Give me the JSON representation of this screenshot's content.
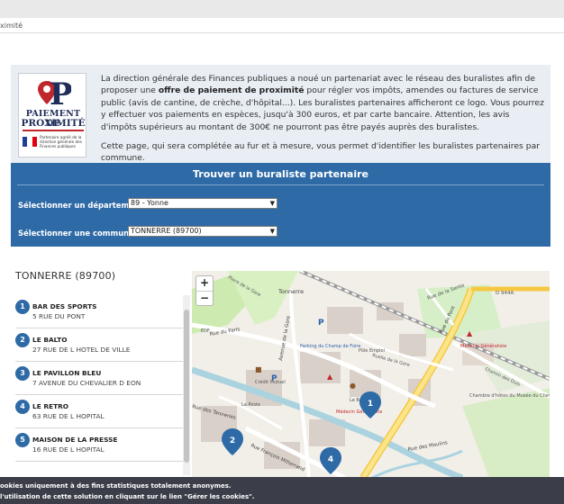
{
  "breadcrumb": {
    "text": "ximité"
  },
  "logo": {
    "line1": "PAIEMENT DE",
    "line2": "PROXIMITÉ",
    "small": "Partenaire agréé de la direction générale des Finances publiques"
  },
  "intro": {
    "p1_a": "La direction générale des Finances publiques a noué un partenariat avec le réseau des buralistes afin de proposer une ",
    "p1_b": "offre de paiement de proximité",
    "p1_c": " pour régler vos impôts, amendes ou factures de service public (avis de cantine, de crèche, d'hôpital...). Les buralistes partenaires afficheront ce logo. Vous pourrez y effectuer vos paiements en espèces, jusqu'à 300 euros, et par carte bancaire. Attention, les avis d'impôts supérieurs au montant de 300€ ne pourront pas être payés auprès des buralistes.",
    "p2": "Cette page, qui sera complétée au fur et à mesure, vous permet d'identifier les buralistes partenaires par commune."
  },
  "finder": {
    "title": "Trouver un buraliste partenaire",
    "dept_label": "Sélectionner un département :",
    "dept_value": "89 - Yonne",
    "commune_label": "Sélectionner une commune :",
    "commune_value": "TONNERRE (89700)"
  },
  "commune_title": "TONNERRE (89700)",
  "results": [
    {
      "n": "1",
      "name": "BAR DES SPORTS",
      "address": "5 RUE DU PONT"
    },
    {
      "n": "2",
      "name": "LE BALTO",
      "address": "27 RUE DE L HOTEL DE VILLE"
    },
    {
      "n": "3",
      "name": "LE PAVILLON BLEU",
      "address": "7 AVENUE DU CHEVALIER D EON"
    },
    {
      "n": "4",
      "name": "LE RETRO",
      "address": "63 RUE DE L HOPITAL"
    },
    {
      "n": "5",
      "name": "MAISON DE LA PRESSE",
      "address": "16 RUE DE L HOPITAL"
    }
  ],
  "map": {
    "zoom_in": "+",
    "zoom_out": "−",
    "labels": {
      "tonnerre": "Tonnerre",
      "rue_sente": "Rue de la Sente",
      "d944a": "D 944A",
      "rue_pont": "Rue du Pont",
      "medecin1": "Médecin Généraliste",
      "chemin_ouis": "Chemin des Ouis",
      "rue_gare": "Ruelle de la Gare",
      "parking": "Parking du Champ de Foire",
      "pole_emploi": "Pôle Emploi",
      "rue_paris": "Rue du Paris",
      "av_gare": "Avenue de la Gare",
      "rue_mitterrand": "Rue François Mitterrand",
      "medecin2": "Médecin Généraliste",
      "credit": "Crédit Mutuel",
      "poste": "La Poste",
      "edf": "EDF",
      "pl_gare": "Place de la Gare",
      "rue_tanneries": "Rue des Tanneries",
      "rue_moulins": "Rue des Moulins",
      "cafe": "Le Bon Café",
      "musee": "Chambre d'hôtes du Musée du Chevalier d'Éon"
    },
    "markers": [
      "1",
      "2",
      "4"
    ]
  },
  "cookie": {
    "line1": "ookies uniquement à des fins statistiques totalement anonymes.",
    "line2": "l'utilisation de cette solution en cliquant sur le lien \"Gérer les cookies\"."
  },
  "colors": {
    "primary": "#2e6aa6",
    "cookie_bg": "#3b3d48",
    "info_bg": "#e8eef4"
  }
}
